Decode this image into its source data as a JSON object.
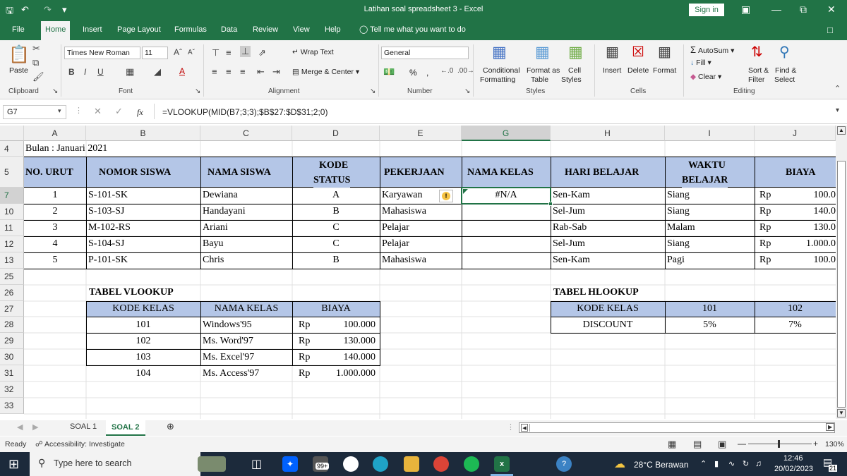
{
  "window": {
    "title": "Latihan soal spreadsheet 3  -  Excel",
    "signin": "Sign in"
  },
  "tabs": [
    "File",
    "Home",
    "Insert",
    "Page Layout",
    "Formulas",
    "Data",
    "Review",
    "View",
    "Help"
  ],
  "tellme": "Tell me what you want to do",
  "ribbon": {
    "clipboard": {
      "paste": "Paste",
      "label": "Clipboard"
    },
    "font": {
      "name": "Times New Roman",
      "size": "11",
      "label": "Font"
    },
    "alignment": {
      "wrap": "Wrap Text",
      "merge": "Merge & Center",
      "label": "Alignment"
    },
    "number": {
      "format": "General",
      "percent": "%",
      "comma": ",",
      "label": "Number"
    },
    "styles": {
      "conditional1": "Conditional",
      "conditional2": "Formatting",
      "formatas1": "Format as",
      "formatas2": "Table",
      "cell1": "Cell",
      "cell2": "Styles",
      "label": "Styles"
    },
    "cells": {
      "insert": "Insert",
      "delete": "Delete",
      "format": "Format",
      "label": "Cells"
    },
    "editing": {
      "autosum": "AutoSum",
      "fill": "Fill",
      "clear": "Clear",
      "sort1": "Sort &",
      "sort2": "Filter",
      "find1": "Find &",
      "find2": "Select",
      "label": "Editing"
    }
  },
  "formula_bar": {
    "namebox": "G7",
    "fx": "fx",
    "formula": "=VLOOKUP(MID(B7;3;3);$B$27:$D$31;2;0)"
  },
  "columns": [
    "A",
    "B",
    "C",
    "D",
    "E",
    "G",
    "H",
    "I",
    "J"
  ],
  "rows": [
    "4",
    "5",
    "7",
    "10",
    "11",
    "12",
    "13",
    "25",
    "26",
    "27",
    "28",
    "29",
    "30",
    "31",
    "32",
    "33"
  ],
  "sheet": {
    "bulan": "Bulan : Januari 2021",
    "headers": {
      "no_urut": "NO. URUT",
      "nomor_siswa": "NOMOR SISWA",
      "nama_siswa": "NAMA SISWA",
      "kode1": "KODE",
      "kode2": "STATUS",
      "pekerjaan": "PEKERJAAN",
      "nama_kelas": "NAMA KELAS",
      "hari": "HARI BELAJAR",
      "waktu1": "WAKTU",
      "waktu2": "BELAJAR",
      "biaya": "BIAYA"
    },
    "data": [
      {
        "no": "1",
        "nomor": "S-101-SK",
        "nama": "Dewiana",
        "kode": "A",
        "pekerjaan": "Karyawan",
        "kelas": "#N/A",
        "hari": "Sen-Kam",
        "waktu": "Siang",
        "rp": "Rp",
        "biaya": "100.0"
      },
      {
        "no": "2",
        "nomor": "S-103-SJ",
        "nama": "Handayani",
        "kode": "B",
        "pekerjaan": "Mahasiswa",
        "kelas": "",
        "hari": "Sel-Jum",
        "waktu": "Siang",
        "rp": "Rp",
        "biaya": "140.0"
      },
      {
        "no": "3",
        "nomor": "M-102-RS",
        "nama": "Ariani",
        "kode": "C",
        "pekerjaan": "Pelajar",
        "kelas": "",
        "hari": "Rab-Sab",
        "waktu": "Malam",
        "rp": "Rp",
        "biaya": "130.0"
      },
      {
        "no": "4",
        "nomor": "S-104-SJ",
        "nama": "Bayu",
        "kode": "C",
        "pekerjaan": "Pelajar",
        "kelas": "",
        "hari": "Sel-Jum",
        "waktu": "Siang",
        "rp": "Rp",
        "biaya": "1.000.0"
      },
      {
        "no": "5",
        "nomor": "P-101-SK",
        "nama": "Chris",
        "kode": "B",
        "pekerjaan": "Mahasiswa",
        "kelas": "",
        "hari": "Sen-Kam",
        "waktu": "Pagi",
        "rp": "Rp",
        "biaya": "100.0"
      }
    ],
    "vlookup": {
      "title": "TABEL VLOOKUP",
      "headers": [
        "KODE KELAS",
        "NAMA KELAS",
        "BIAYA"
      ],
      "rows": [
        {
          "kode": "101",
          "nama": "Windows'95",
          "rp": "Rp",
          "biaya": "100.000"
        },
        {
          "kode": "102",
          "nama": "Ms. Word'97",
          "rp": "Rp",
          "biaya": "130.000"
        },
        {
          "kode": "103",
          "nama": "Ms. Excel'97",
          "rp": "Rp",
          "biaya": "140.000"
        },
        {
          "kode": "104",
          "nama": "Ms. Access'97",
          "rp": "Rp",
          "biaya": "1.000.000"
        }
      ]
    },
    "hlookup": {
      "title": "TABEL HLOOKUP",
      "kode_label": "KODE KELAS",
      "k1": "101",
      "k2": "102",
      "disc_label": "DISCOUNT",
      "d1": "5%",
      "d2": "7%"
    }
  },
  "sheet_tabs": [
    "SOAL 1",
    "SOAL 2"
  ],
  "status": {
    "ready": "Ready",
    "accessibility": "Accessibility: Investigate",
    "zoom": "130%"
  },
  "taskbar": {
    "search": "Type here to search",
    "badge": "99+",
    "weather": "28°C  Berawan",
    "time": "12:46",
    "date": "20/02/2023",
    "notif": "21"
  }
}
